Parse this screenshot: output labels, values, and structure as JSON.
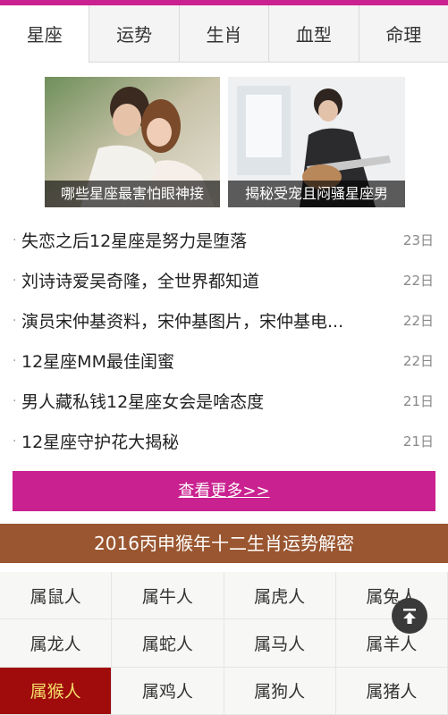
{
  "tabs": [
    {
      "label": "星座",
      "active": true
    },
    {
      "label": "运势",
      "active": false
    },
    {
      "label": "生肖",
      "active": false
    },
    {
      "label": "血型",
      "active": false
    },
    {
      "label": "命理",
      "active": false
    }
  ],
  "featured": [
    {
      "caption": "哪些星座最害怕眼神接"
    },
    {
      "caption": "揭秘受宠且闷骚星座男"
    }
  ],
  "news": [
    {
      "title": "失恋之后12星座是努力是堕落",
      "date": "23日"
    },
    {
      "title": "刘诗诗爱吴奇隆，全世界都知道",
      "date": "22日"
    },
    {
      "title": "演员宋仲基资料，宋仲基图片，宋仲基电...",
      "date": "22日"
    },
    {
      "title": "12星座MM最佳闺蜜",
      "date": "22日"
    },
    {
      "title": "男人藏私钱12星座女会是啥态度",
      "date": "21日"
    },
    {
      "title": "12星座守护花大揭秘",
      "date": "21日"
    }
  ],
  "more_label": "查看更多>>",
  "zodiac": {
    "banner": "2016丙申猴年十二生肖运势解密",
    "items": [
      "属鼠人",
      "属牛人",
      "属虎人",
      "属兔人",
      "属龙人",
      "属蛇人",
      "属马人",
      "属羊人",
      "属猴人",
      "属鸡人",
      "属狗人",
      "属猪人"
    ],
    "active_index": 8
  },
  "colors": {
    "accent": "#c9218f",
    "banner": "#9a5630",
    "active_cell": "#a00b0b",
    "active_cell_text": "#f5dd6a"
  },
  "icons": {
    "back_to_top": "arrow-up-icon"
  }
}
